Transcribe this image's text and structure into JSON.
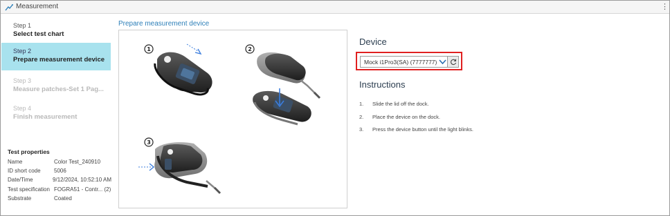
{
  "window": {
    "title": "Measurement"
  },
  "steps": [
    {
      "num": "Step 1",
      "name": "Select test chart",
      "state": "done"
    },
    {
      "num": "Step 2",
      "name": "Prepare measurement device",
      "state": "active"
    },
    {
      "num": "Step 3",
      "name": "Measure patches-Set 1 Pag...",
      "state": "disabled"
    },
    {
      "num": "Step 4",
      "name": "Finish measurement",
      "state": "disabled"
    }
  ],
  "test_properties": {
    "heading": "Test properties",
    "rows": [
      {
        "key": "Name",
        "value": "Color Test_240910"
      },
      {
        "key": "ID short code",
        "value": "5006"
      },
      {
        "key": "Date/Time",
        "value": "9/12/2024, 10:52:10 AM"
      },
      {
        "key": "Test specification",
        "value": "FOGRA51 - Contr... (2)"
      },
      {
        "key": "Substrate",
        "value": "Coated"
      }
    ]
  },
  "main": {
    "title": "Prepare measurement device",
    "illustration_markers": [
      "1",
      "2",
      "3"
    ]
  },
  "device": {
    "heading": "Device",
    "selected": "Mock i1Pro3(SA) (7777777)"
  },
  "instructions": {
    "heading": "Instructions",
    "items": [
      {
        "n": "1.",
        "text": "Slide the lid off the dock."
      },
      {
        "n": "2.",
        "text": "Place the device on the dock."
      },
      {
        "n": "3.",
        "text": "Press the device button until the light blinks."
      }
    ]
  },
  "colors": {
    "accent": "#2d7fb8",
    "active_step_bg": "#a8e2ee",
    "highlight_border": "#e02020"
  }
}
